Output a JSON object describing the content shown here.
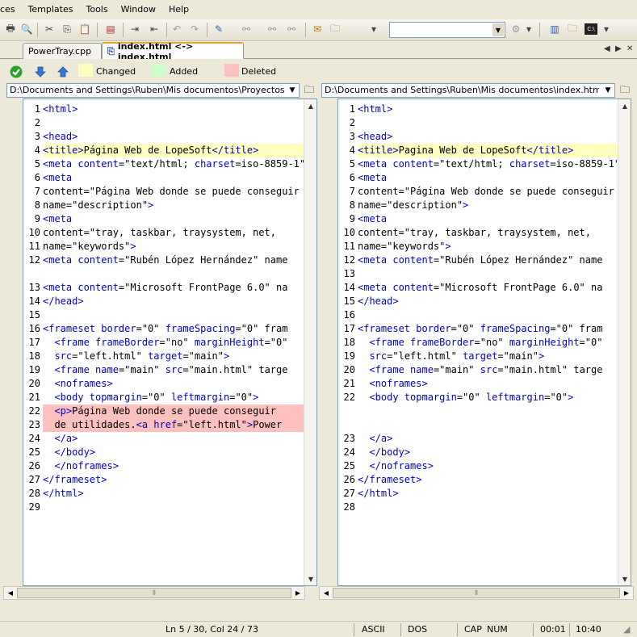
{
  "menu": [
    "ces",
    "Templates",
    "Tools",
    "Window",
    "Help"
  ],
  "tabs": [
    {
      "label": "PowerTray.cpp",
      "active": false
    },
    {
      "label": "index.html <-> index.html",
      "active": true
    }
  ],
  "legend": {
    "changed": "Changed",
    "added": "Added",
    "deleted": "Deleted"
  },
  "colors": {
    "changed": "#ffffc0",
    "added": "#ccffcc",
    "deleted": "#ffc0c0",
    "tag": "#0000c0"
  },
  "left": {
    "path": "D:\\Documents and Settings\\Ruben\\Mis documentos\\Proyectos\\Web\\index.html",
    "lines": [
      {
        "n": "1",
        "t": "<html>",
        "k": ""
      },
      {
        "n": "2",
        "t": "",
        "k": ""
      },
      {
        "n": "3",
        "t": "<head>",
        "k": ""
      },
      {
        "n": "4",
        "t": "<title>Página Web de LopeSoft</title>",
        "k": "changed"
      },
      {
        "n": "5",
        "t": "<meta content=\"text/html; charset=iso-8859-1\"",
        "k": ""
      },
      {
        "n": "6",
        "t": "<meta",
        "k": ""
      },
      {
        "n": "7",
        "t": "content=\"Página Web donde se puede conseguir",
        "k": ""
      },
      {
        "n": "8",
        "t": "name=\"description\">",
        "k": ""
      },
      {
        "n": "9",
        "t": "<meta",
        "k": ""
      },
      {
        "n": "10",
        "t": "content=\"tray, taskbar, traysystem, net, ",
        "k": ""
      },
      {
        "n": "11",
        "t": "name=\"keywords\">",
        "k": ""
      },
      {
        "n": "12",
        "t": "<meta content=\"Rubén López Hernández\" name",
        "k": ""
      },
      {
        "n": "",
        "t": "",
        "k": ""
      },
      {
        "n": "13",
        "t": "<meta content=\"Microsoft FrontPage 6.0\" na",
        "k": ""
      },
      {
        "n": "14",
        "t": "</head>",
        "k": ""
      },
      {
        "n": "15",
        "t": "",
        "k": ""
      },
      {
        "n": "16",
        "t": "<frameset border=\"0\" frameSpacing=\"0\" fram",
        "k": ""
      },
      {
        "n": "17",
        "t": "  <frame frameBorder=\"no\" marginHeight=\"0\"",
        "k": ""
      },
      {
        "n": "18",
        "t": "  src=\"left.html\" target=\"main\">",
        "k": ""
      },
      {
        "n": "19",
        "t": "  <frame name=\"main\" src=\"main.html\" targe",
        "k": ""
      },
      {
        "n": "20",
        "t": "  <noframes>",
        "k": ""
      },
      {
        "n": "21",
        "t": "  <body topmargin=\"0\" leftmargin=\"0\">",
        "k": ""
      },
      {
        "n": "22",
        "t": "  <p>Página Web donde se puede conseguir ",
        "k": "deleted"
      },
      {
        "n": "23",
        "t": "  de utilidades.<a href=\"left.html\">Power",
        "k": "deleted"
      },
      {
        "n": "24",
        "t": "  </a>",
        "k": ""
      },
      {
        "n": "25",
        "t": "  </body>",
        "k": ""
      },
      {
        "n": "26",
        "t": "  </noframes>",
        "k": ""
      },
      {
        "n": "27",
        "t": "</frameset>",
        "k": ""
      },
      {
        "n": "28",
        "t": "</html>",
        "k": ""
      },
      {
        "n": "29",
        "t": "",
        "k": ""
      }
    ]
  },
  "right": {
    "path": "D:\\Documents and Settings\\Ruben\\Mis documentos\\index.html",
    "lines": [
      {
        "n": "1",
        "t": "<html>",
        "k": ""
      },
      {
        "n": "2",
        "t": "",
        "k": ""
      },
      {
        "n": "3",
        "t": "<head>",
        "k": ""
      },
      {
        "n": "4",
        "t": "<title>Pagina Web de LopeSoft</title>",
        "k": "changed"
      },
      {
        "n": "5",
        "t": "<meta content=\"text/html; charset=iso-8859-1\"",
        "k": ""
      },
      {
        "n": "6",
        "t": "<meta",
        "k": ""
      },
      {
        "n": "7",
        "t": "content=\"Página Web donde se puede conseguir",
        "k": ""
      },
      {
        "n": "8",
        "t": "name=\"description\">",
        "k": ""
      },
      {
        "n": "9",
        "t": "<meta",
        "k": ""
      },
      {
        "n": "10",
        "t": "content=\"tray, taskbar, traysystem, net, ",
        "k": ""
      },
      {
        "n": "11",
        "t": "name=\"keywords\">",
        "k": ""
      },
      {
        "n": "12",
        "t": "<meta content=\"Rubén López Hernández\" name",
        "k": ""
      },
      {
        "n": "13",
        "t": "",
        "k": "added"
      },
      {
        "n": "14",
        "t": "<meta content=\"Microsoft FrontPage 6.0\" na",
        "k": ""
      },
      {
        "n": "15",
        "t": "</head>",
        "k": ""
      },
      {
        "n": "16",
        "t": "",
        "k": ""
      },
      {
        "n": "17",
        "t": "<frameset border=\"0\" frameSpacing=\"0\" fram",
        "k": ""
      },
      {
        "n": "18",
        "t": "  <frame frameBorder=\"no\" marginHeight=\"0\"",
        "k": ""
      },
      {
        "n": "19",
        "t": "  src=\"left.html\" target=\"main\">",
        "k": ""
      },
      {
        "n": "20",
        "t": "  <frame name=\"main\" src=\"main.html\" targe",
        "k": ""
      },
      {
        "n": "21",
        "t": "  <noframes>",
        "k": ""
      },
      {
        "n": "22",
        "t": "  <body topmargin=\"0\" leftmargin=\"0\">",
        "k": ""
      },
      {
        "n": "",
        "t": "",
        "k": ""
      },
      {
        "n": "",
        "t": "",
        "k": ""
      },
      {
        "n": "23",
        "t": "  </a>",
        "k": ""
      },
      {
        "n": "24",
        "t": "  </body>",
        "k": ""
      },
      {
        "n": "25",
        "t": "  </noframes>",
        "k": ""
      },
      {
        "n": "26",
        "t": "</frameset>",
        "k": ""
      },
      {
        "n": "27",
        "t": "</html>",
        "k": ""
      },
      {
        "n": "28",
        "t": "",
        "k": ""
      }
    ]
  },
  "status": {
    "position": "Ln 5 / 30, Col 24 / 73",
    "encoding": "ASCII",
    "format": "DOS",
    "caps": "CAP",
    "num": "NUM",
    "elapsed": "00:01",
    "clock": "10:40"
  }
}
